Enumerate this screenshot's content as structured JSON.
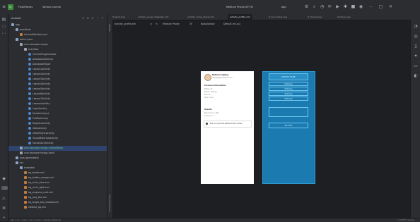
{
  "titlebar": {
    "project_badge": "FA",
    "project_name": "FinalFitness",
    "vcs": "Version control",
    "run_config": "app",
    "device": "Medium Phone API 35",
    "right_icons": [
      "gear-icon",
      "search-icon",
      "bell-icon",
      "sync-icon",
      "run-icon",
      "debug-icon",
      "stop-icon",
      "profile-icon",
      "minimize-icon",
      "maximize-icon",
      "close-icon"
    ]
  },
  "left_strip_icons": [
    "folder-icon",
    "commit-icon",
    "more-icon",
    "android-icon",
    "terminal-icon",
    "problems-icon",
    "logcat-icon",
    "git-icon"
  ],
  "project": {
    "header": "Android",
    "tools": "+  ⊙  ≡  ⋮  —",
    "tree": [
      {
        "label": "app",
        "type": "folder",
        "indent": 0
      },
      {
        "label": "manifests",
        "type": "folder",
        "indent": 1
      },
      {
        "label": "AndroidManifest.xml",
        "type": "xml",
        "indent": 2
      },
      {
        "label": "kotlin+java",
        "type": "folder",
        "indent": 1
      },
      {
        "label": "com.example.myapp",
        "type": "pkg",
        "indent": 2
      },
      {
        "label": "activities",
        "type": "pkg",
        "indent": 3
      },
      {
        "label": "CircularProgressView",
        "type": "class",
        "indent": 4
      },
      {
        "label": "DashboardActivity",
        "type": "class",
        "indent": 4
      },
      {
        "label": "DatabaseHelper",
        "type": "class",
        "indent": 4
      },
      {
        "label": "Lesson1Activity",
        "type": "class",
        "indent": 4
      },
      {
        "label": "Lesson2Activity",
        "type": "class",
        "indent": 4
      },
      {
        "label": "Lesson3Activity",
        "type": "class",
        "indent": 4
      },
      {
        "label": "Lesson4Activity",
        "type": "class",
        "indent": 4
      },
      {
        "label": "Lesson5Activity",
        "type": "class",
        "indent": 4
      },
      {
        "label": "Lesson6Activity",
        "type": "class",
        "indent": 4
      },
      {
        "label": "Lesson7Activity",
        "type": "class",
        "indent": 4
      },
      {
        "label": "LessonsActivity",
        "type": "class",
        "indent": 4
      },
      {
        "label": "LoginActivity",
        "type": "class",
        "indent": 4
      },
      {
        "label": "MainActivity.kt",
        "type": "class",
        "indent": 4
      },
      {
        "label": "ProfileActivity",
        "type": "class",
        "indent": 4
      },
      {
        "label": "RegisterActivity",
        "type": "class",
        "indent": 4
      },
      {
        "label": "StatsActivity",
        "type": "class",
        "indent": 4
      },
      {
        "label": "VideoPlayerActivity",
        "type": "class",
        "indent": 4
      },
      {
        "label": "VisualMaterialsActivity",
        "type": "class",
        "indent": 4
      },
      {
        "label": "VocabularyActivity",
        "type": "class",
        "indent": 4
      },
      {
        "label": "com.example.myapp (androidTest)",
        "type": "pkg",
        "indent": 2,
        "selected": true
      },
      {
        "label": "com.example.myapp (test)",
        "type": "pkg",
        "indent": 2
      },
      {
        "label": "java (generated)",
        "type": "folder",
        "indent": 1
      },
      {
        "label": "res",
        "type": "folder",
        "indent": 1
      },
      {
        "label": "drawable",
        "type": "folder",
        "indent": 2
      },
      {
        "label": "bg_border.xml",
        "type": "xml",
        "indent": 3
      },
      {
        "label": "bg_button_orange.xml",
        "type": "xml",
        "indent": 3
      },
      {
        "label": "bg_circle_blue.xml",
        "type": "xml",
        "indent": 3
      },
      {
        "label": "bg_circle_light.xml",
        "type": "xml",
        "indent": 3
      },
      {
        "label": "bg_progress_card.xml",
        "type": "xml",
        "indent": 3
      },
      {
        "label": "bg_play_btn.xml",
        "type": "xml",
        "indent": 3
      },
      {
        "label": "bg_target_box_shadow.xml",
        "type": "xml",
        "indent": 3
      },
      {
        "label": "edittext_bg.xml",
        "type": "xml",
        "indent": 3
      }
    ]
  },
  "tabs": [
    {
      "label": "it_stock.png",
      "active": false
    },
    {
      "label": "activity_visual_materials.xml",
      "active": false
    },
    {
      "label": "activity_video_player.xml",
      "active": false
    },
    {
      "label": "activity_profile.xml",
      "active": true
    },
    {
      "label": "it_zero_there.png",
      "active": false
    },
    {
      "label": "it_cheers.png",
      "active": false
    },
    {
      "label": "it_tokyo.png",
      "active": false
    }
  ],
  "toolbar": {
    "file": "activity_profile.xml",
    "device": "Medium Phone",
    "api": "35",
    "theme": "NoActionBar",
    "locale": "Default (en-us)"
  },
  "vstrip": {
    "top_label": "Palette",
    "bottom_label": "Component Tree"
  },
  "right_strip_icons": [
    "notifications-icon",
    "gradle-icon",
    "device-manager-icon",
    "gemini-icon",
    "running-devices-icon",
    "emulator-icon"
  ],
  "phone": {
    "name": "Nataly Longling",
    "email": "natalyl@example.com",
    "section_personal": "Personal Information",
    "fields": [
      "Name: N",
      "Email: natalyl",
      "Phone: -",
      "Role: user"
    ],
    "section_results": "Results",
    "results_lines": [
      "Best score: 100",
      "Lessons: 7"
    ],
    "edit_button": "Edit your personal details at test (7 tests)"
  },
  "blueprint": {
    "header": "PROFILE NAME",
    "rows": [
      "TextView",
      "TextView",
      "TextView",
      "TextView"
    ],
    "button_label": "BUTTON"
  },
  "status": {
    "left": "app > src > main > res > layout > activity_profile.xml",
    "right": "LF  UTF-8  4 spaces"
  }
}
